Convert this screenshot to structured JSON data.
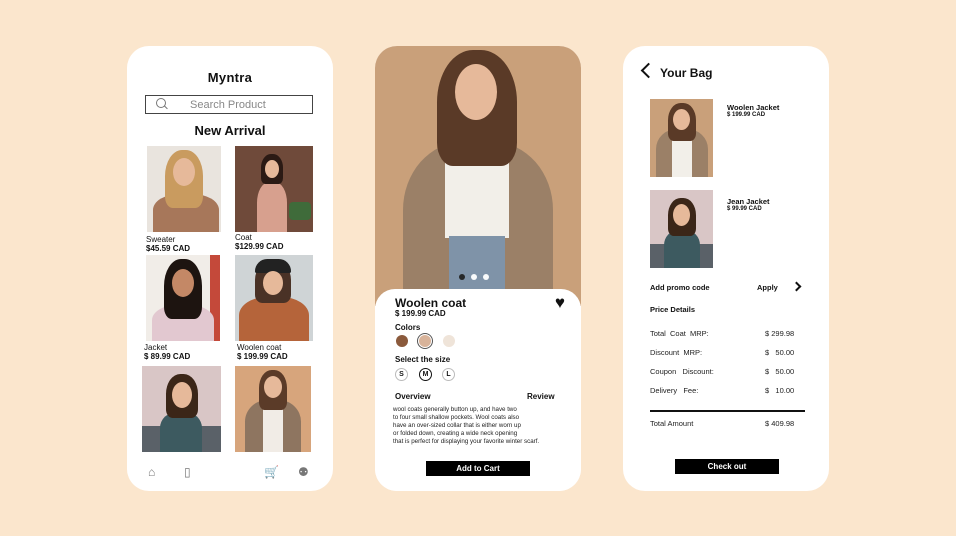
{
  "shop": {
    "brand": "Myntra",
    "search_placeholder": "Search Product",
    "heading": "New Arrival",
    "products": [
      {
        "name": "Sweater",
        "price": "$45.59 CAD"
      },
      {
        "name": "Coat",
        "price": "$129.99 CAD"
      },
      {
        "name": "Jacket",
        "price": "$ 89.99  CAD"
      },
      {
        "name": "Woolen coat",
        "price": "$ 199.99 CAD"
      }
    ],
    "nav_icons": [
      "home-icon",
      "bookmark-icon",
      "cart-icon",
      "profile-icon"
    ]
  },
  "detail": {
    "title": "Woolen coat",
    "price": "$ 199.99 CAD",
    "colors_label": "Colors",
    "colors": [
      "#8b5a3c",
      "#d8b39a",
      "#efe4d9"
    ],
    "size_label": "Select the size",
    "sizes": [
      "S",
      "M",
      "L"
    ],
    "selected_size": "M",
    "tab_overview": "Overview",
    "tab_review": "Review",
    "description": [
      "wool coats generally button up, and have two",
      "to four small shallow pockets. Wool coats also",
      "have an over-sized collar that is either worn up",
      "or folded down, creating a wide neck opening",
      "that is perfect for displaying your favorite winter scarf."
    ],
    "add_to_cart": "Add to Cart"
  },
  "bag": {
    "title": "Your Bag",
    "items": [
      {
        "name": "Woolen Jacket",
        "price": "$ 199.99 CAD"
      },
      {
        "name": "Jean Jacket",
        "price": "$ 99.99 CAD"
      }
    ],
    "promo_label": "Add promo code",
    "apply": "Apply",
    "price_details": "Price Details",
    "rows": [
      {
        "label": "Total  Coat  MRP:",
        "value": "$ 299.98"
      },
      {
        "label": "Discount  MRP:",
        "value": "$   50.00"
      },
      {
        "label": "Coupon   Discount:",
        "value": "$   50.00"
      },
      {
        "label": "Delivery   Fee:",
        "value": "$   10.00"
      }
    ],
    "total_label": "Total Amount",
    "total_value": "$ 409.98",
    "checkout": "Check out"
  },
  "colors": {
    "background": "#fbe6cd",
    "card": "#ffffff",
    "button": "#000000"
  }
}
